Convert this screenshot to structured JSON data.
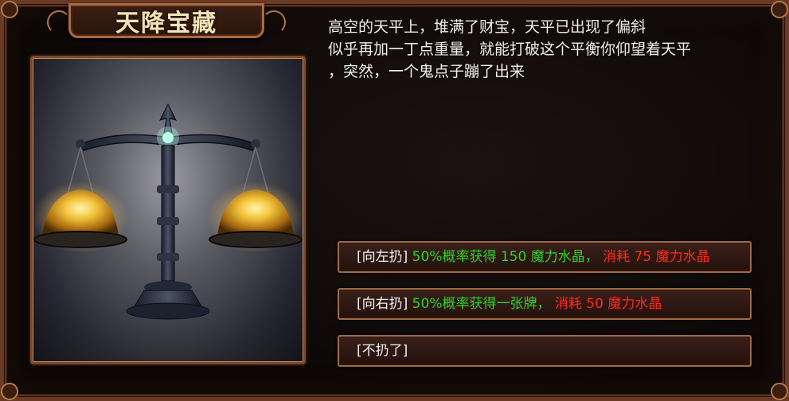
{
  "title": "天降宝藏",
  "story": {
    "line1": "高空的天平上，堆满了财宝，天平已出现了偏斜",
    "line2": "似乎再加一丁点重量，就能打破这个平衡你仰望着天平",
    "line3": "，突然，一个鬼点子蹦了出来"
  },
  "options": [
    {
      "prefix": "[向左扔]",
      "gain": "50%概率获得 150 魔力水晶，",
      "cost": "消耗 75 魔力水晶"
    },
    {
      "prefix": "[向右扔]",
      "gain": "50%概率获得一张牌，",
      "cost": "消耗 50 魔力水晶"
    },
    {
      "prefix": "[不扔了]",
      "gain": "",
      "cost": ""
    }
  ],
  "colors": {
    "gain": "#2fd12f",
    "cost": "#ff2a1e",
    "frame": "#9c6a48"
  },
  "image": {
    "depicts": "scale-of-treasure-icon"
  }
}
